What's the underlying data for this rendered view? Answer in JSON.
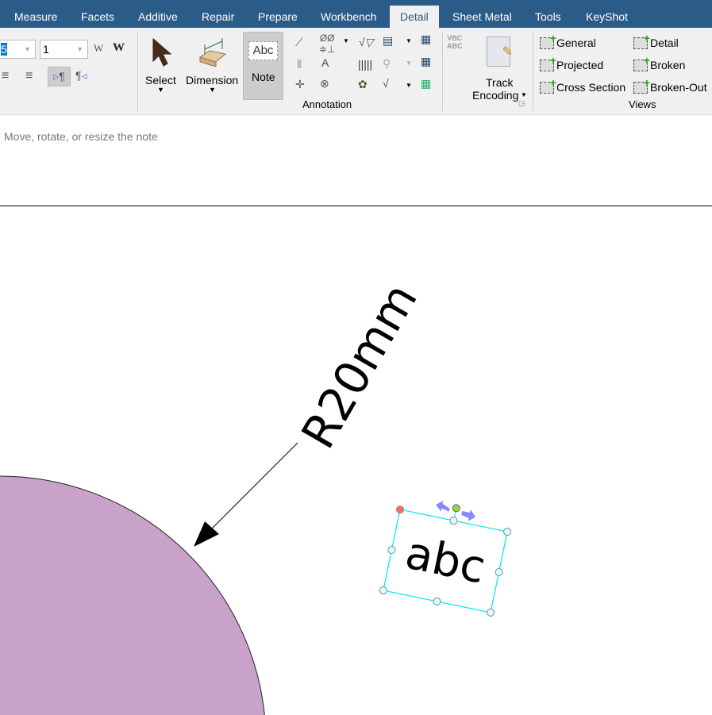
{
  "tabs": [
    "Measure",
    "Facets",
    "Additive",
    "Repair",
    "Prepare",
    "Workbench",
    "Detail",
    "Sheet Metal",
    "Tools",
    "KeyShot"
  ],
  "active_tab": "Detail",
  "format": {
    "font_size_value": "5",
    "line_value": "1"
  },
  "tools": {
    "select": "Select",
    "dimension": "Dimension",
    "note": "Note",
    "track": "Track",
    "encoding": "Encoding"
  },
  "groups": {
    "annotation": "Annotation",
    "views": "Views"
  },
  "views": [
    "General",
    "Projected",
    "Cross Section",
    "Detail",
    "Broken",
    "Broken-Out"
  ],
  "status_hint": "Move, rotate, or resize the note",
  "drawing": {
    "dimension_text": "R20mm",
    "note_text": "abc",
    "circle_color": "#c8a2c8",
    "selection_color": "#00e5ff"
  }
}
